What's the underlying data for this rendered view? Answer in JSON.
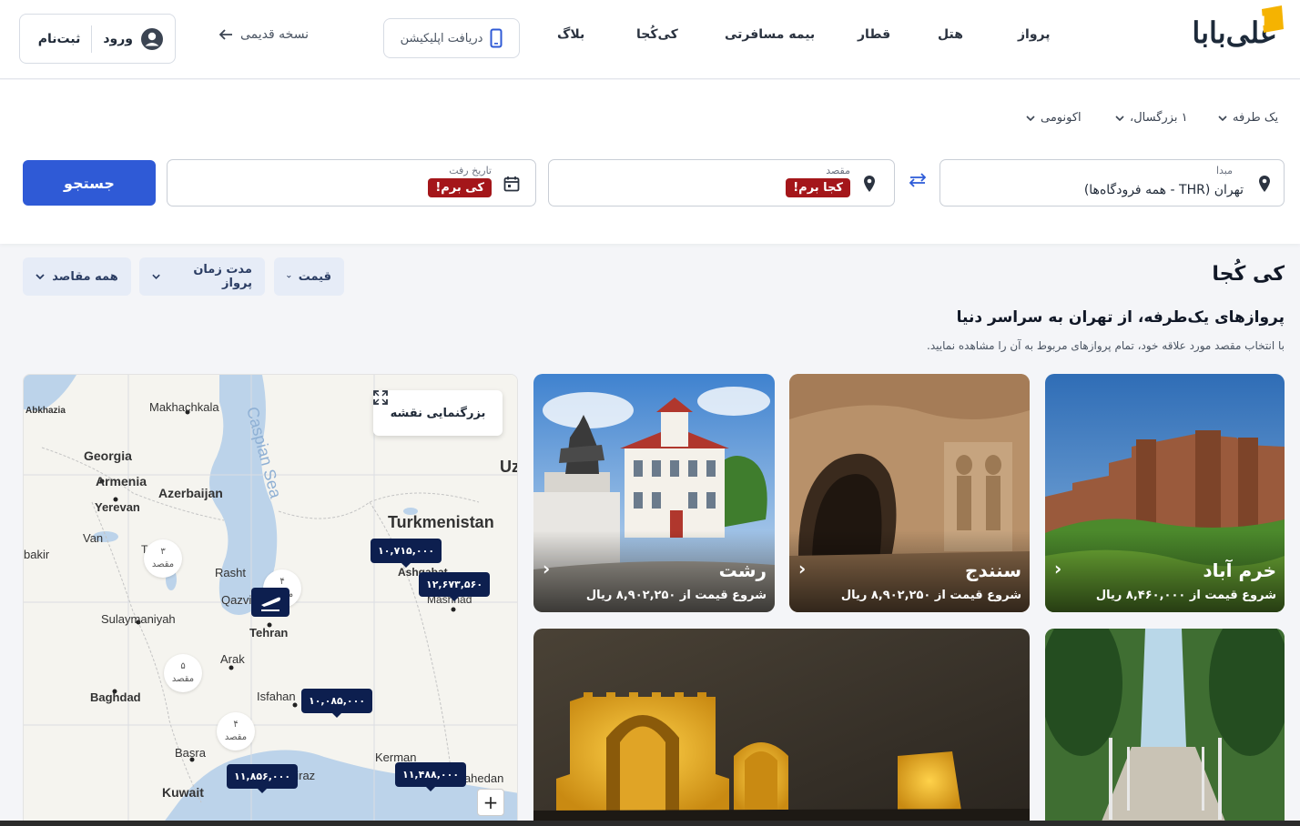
{
  "header": {
    "logo_text": "علی‌بابا",
    "nav": [
      "پرواز",
      "هتل",
      "قطار",
      "بیمه مسافرتی",
      "کی‌کُجا",
      "بلاگ"
    ],
    "app_button": "دریافت اپلیکیشن",
    "old_version": "نسخه قدیمی",
    "login": "ورود",
    "signup": "ثبت‌نام"
  },
  "search": {
    "trip_type": "یک طرفه",
    "passengers": "۱ بزرگسال،",
    "cabin": "اکونومی",
    "origin_label": "مبدا",
    "origin_value": "تهران (THR - همه فرودگاه‌ها)",
    "dest_label": "مقصد",
    "dest_tag": "کجا برم!",
    "date_label": "تاریخ رفت",
    "date_tag": "کی برم!",
    "search_button": "جستجو"
  },
  "section": {
    "title": "کی کُجا",
    "subtitle": "پروازهای یک‌طرفه، از تهران به سراسر دنیا",
    "description": "با انتخاب مقصد مورد علاقه خود، تمام پروازهای مربوط به آن را مشاهده نمایید.",
    "filters": [
      "قیمت",
      "مدت زمان پرواز",
      "همه مقاصد"
    ]
  },
  "map": {
    "enlarge_label": "بزرگنمایی نقشه",
    "labels": [
      "Abkhazia",
      "Makhachkala",
      "Caspian Sea",
      "Georgia",
      "Armenia",
      "Azerbaijan",
      "Yerevan",
      "Turkmenistan",
      "Uz",
      "Van",
      "bakir",
      "Rasht",
      "Qazvi",
      "Ashgabat",
      "Mashhad",
      "Sulaymaniyah",
      "Tehran",
      "Arak",
      "Isfahan",
      "Baghdad",
      "Basra",
      "Kerman",
      "Zahedan",
      "Kuwait",
      "hiraz",
      "T"
    ],
    "prices": [
      "۱۰,۷۱۵,۰۰۰",
      "۱۲,۶۷۳,۵۶۰",
      "۱۰,۰۸۵,۰۰۰",
      "۱۱,۸۵۶,۰۰۰",
      "۱۱,۴۸۸,۰۰۰"
    ],
    "clusters": [
      {
        "count": "۳",
        "label": "مقصد"
      },
      {
        "count": "۴",
        "label": "مقصد"
      },
      {
        "count": "۵",
        "label": "مقصد"
      },
      {
        "count": "۴",
        "label": "مقصد"
      }
    ],
    "zoom_in": "+"
  },
  "cards": [
    {
      "name": "خرم آباد",
      "price": "شروع قیمت از ۸,۴۶۰,۰۰۰ ریال"
    },
    {
      "name": "سنندج",
      "price": "شروع قیمت از ۸,۹۰۲,۲۵۰ ریال"
    },
    {
      "name": "رشت",
      "price": "شروع قیمت از ۸,۹۰۲,۲۵۰ ریال"
    }
  ],
  "colors": {
    "primary": "#2f5ad6",
    "tag_red": "#a4161a",
    "map_pin": "#0d1f4f"
  }
}
